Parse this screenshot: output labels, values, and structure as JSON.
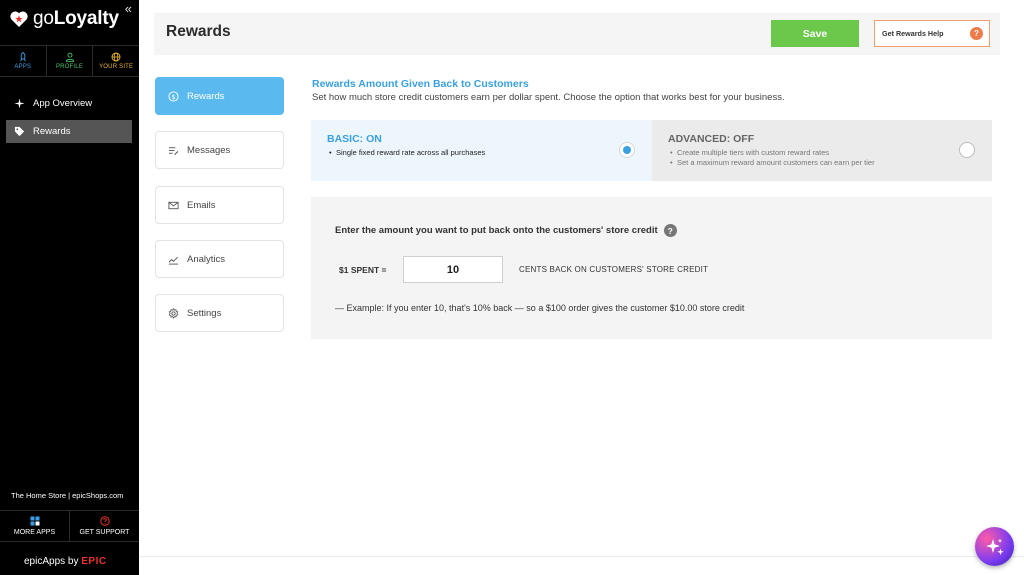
{
  "sidebar": {
    "brand_prefix": "go",
    "brand_bold": "Loyalty",
    "collapse_icon": "«",
    "topnav": [
      {
        "label": "APPS",
        "icon": "rocket-icon",
        "color": "#3a9fe6"
      },
      {
        "label": "PROFILE",
        "icon": "user-icon",
        "color": "#4cc46a"
      },
      {
        "label": "YOUR SITE",
        "icon": "globe-icon",
        "color": "#f0b92e"
      }
    ],
    "nav": [
      {
        "label": "App Overview",
        "icon": "sparkle-icon",
        "active": false
      },
      {
        "label": "Rewards",
        "icon": "tag-icon",
        "active": true
      }
    ],
    "store": "The Home Store | epicShops.com",
    "bottomnav": [
      {
        "label": "MORE APPS",
        "icon": "grid-icon"
      },
      {
        "label": "GET SUPPORT",
        "icon": "help-icon",
        "color": "#e8322a"
      }
    ],
    "footer_prefix": "epicApps by",
    "footer_brand": "EPIC"
  },
  "header": {
    "title": "Rewards",
    "save_label": "Save",
    "help_label": "Get Rewards Help",
    "help_icon": "?"
  },
  "tabs": [
    {
      "label": "Rewards",
      "icon": "dollar-icon",
      "active": true
    },
    {
      "label": "Messages",
      "icon": "messages-icon",
      "active": false
    },
    {
      "label": "Emails",
      "icon": "mail-icon",
      "active": false
    },
    {
      "label": "Analytics",
      "icon": "chart-icon",
      "active": false
    },
    {
      "label": "Settings",
      "icon": "gear-icon",
      "active": false
    }
  ],
  "main": {
    "title": "Rewards Amount Given Back to Customers",
    "subtitle": "Set how much store credit customers earn per dollar spent. Choose the option that works best for your business.",
    "basic": {
      "title": "BASIC: ON",
      "bullets": [
        "Single fixed reward rate across all purchases"
      ],
      "selected": true
    },
    "advanced": {
      "title": "ADVANCED: OFF",
      "bullets": [
        "Create multiple tiers with custom reward rates",
        "Set a maximum reward amount customers can earn per tier"
      ],
      "selected": false
    },
    "amount": {
      "prompt": "Enter the amount you want to put back onto the customers' store credit",
      "help_icon": "?",
      "spent_label": "$1 SPENT =",
      "value": "10",
      "cents_label": "CENTS BACK ON CUSTOMERS' STORE CREDIT",
      "example": "— Example: If you enter 10, that's 10% back — so a $100 order gives the customer $10.00 store credit"
    }
  },
  "colors": {
    "accent": "#3aa0e0",
    "save": "#6cc84a",
    "help": "#ee7b4a",
    "active_tab": "#5abaf0"
  }
}
